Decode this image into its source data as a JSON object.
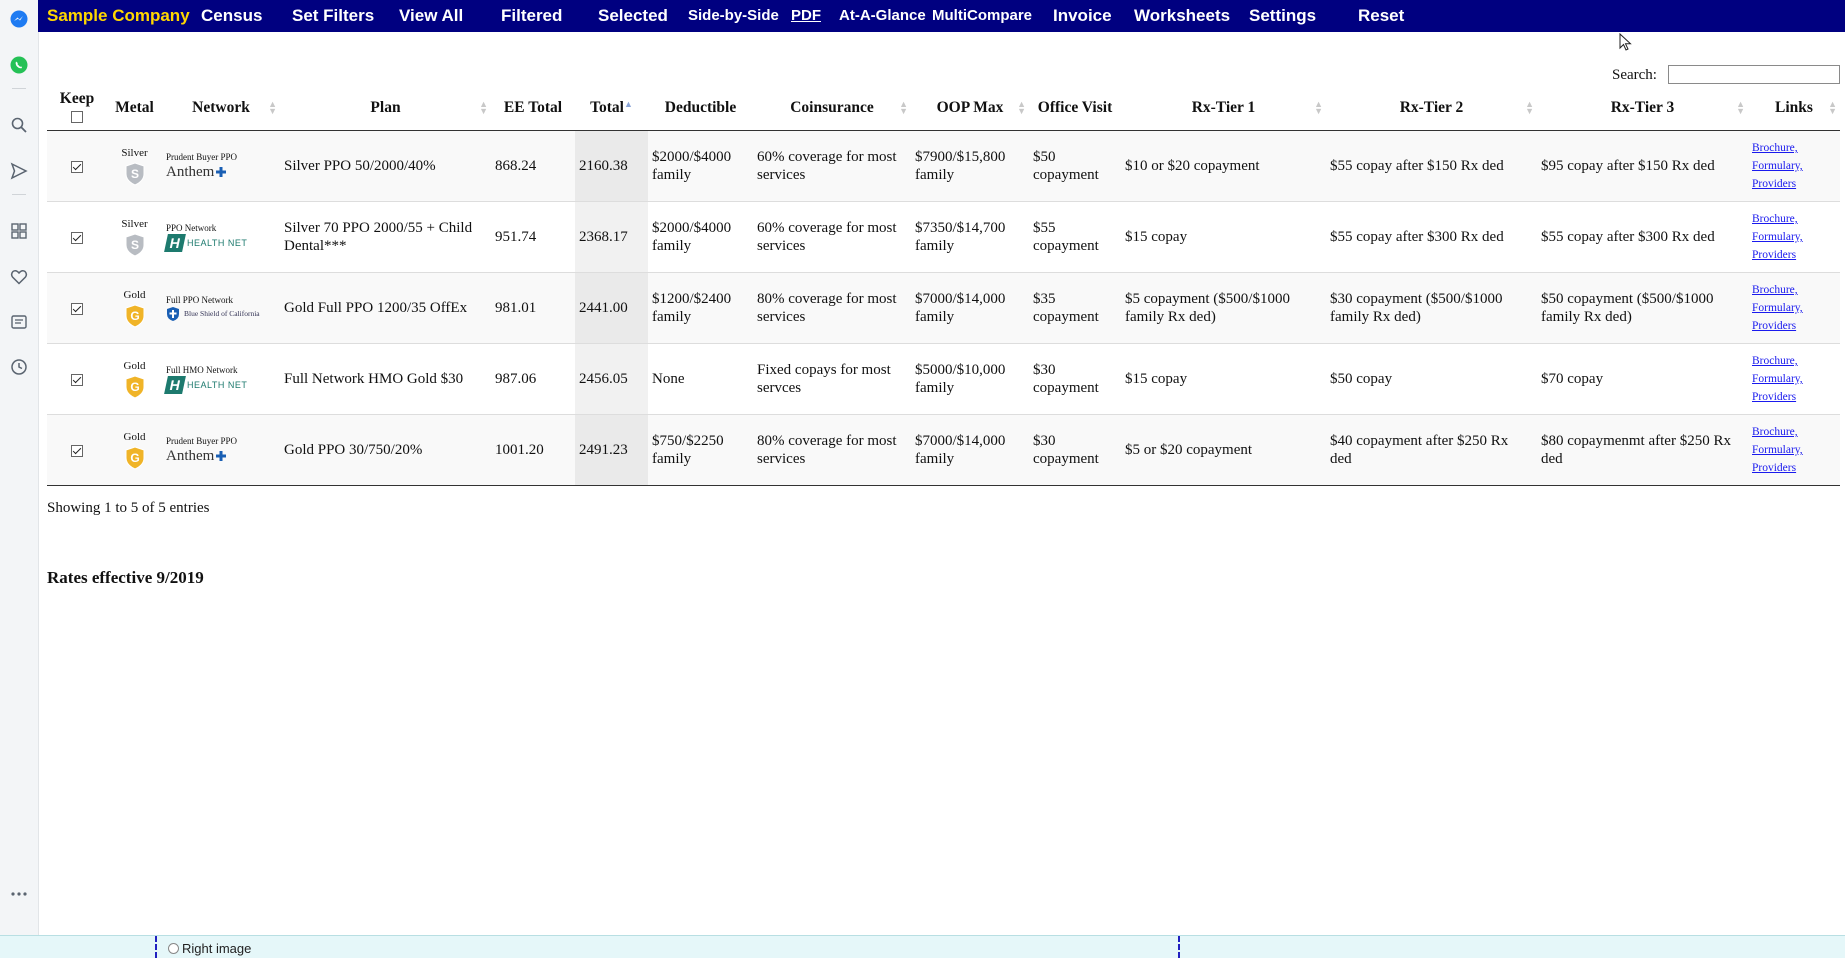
{
  "nav": {
    "brand": "Sample Company",
    "items": [
      "Census",
      "Set Filters",
      "View All",
      "Filtered",
      "Selected",
      "Side-by-Side",
      "PDF",
      "At-A-Glance",
      "MultiCompare",
      "Invoice",
      "Worksheets",
      "Settings",
      "Reset"
    ]
  },
  "sidebar": {
    "icons": [
      "messenger-icon",
      "whatsapp-icon",
      "search-icon",
      "send-icon",
      "apps-grid-icon",
      "heart-icon",
      "news-icon",
      "clock-icon",
      "more-icon"
    ]
  },
  "search": {
    "label": "Search:",
    "value": "",
    "placeholder": ""
  },
  "table": {
    "headers": {
      "keep": "Keep",
      "metal": "Metal",
      "network": "Network",
      "plan": "Plan",
      "ee_total": "EE Total",
      "total": "Total",
      "deductible": "Deductible",
      "coinsurance": "Coinsurance",
      "oop_max": "OOP Max",
      "office_visit": "Office Visit",
      "rx1": "Rx-Tier 1",
      "rx2": "Rx-Tier 2",
      "rx3": "Rx-Tier 3",
      "links": "Links"
    },
    "rows": [
      {
        "metal": "Silver",
        "badge_letter": "S",
        "badge_color": "#b8bcc2",
        "network_label": "Prudent Buyer PPO",
        "carrier": "Anthem",
        "plan": "Silver PPO 50/2000/40%",
        "ee_total": "868.24",
        "total": "2160.38",
        "deductible": "$2000/$4000 family",
        "coinsurance": "60% coverage for most services",
        "oop_max": "$7900/$15,800 family",
        "office_visit": "$50 copayment",
        "rx1": "$10 or $20 copayment",
        "rx2": "$55 copay after $150 Rx ded",
        "rx3": "$95 copay after $150 Rx ded",
        "links": [
          "Brochure,",
          "Formulary,",
          "Providers"
        ]
      },
      {
        "metal": "Silver",
        "badge_letter": "S",
        "badge_color": "#b8bcc2",
        "network_label": "PPO Network",
        "carrier": "HEALTH NET",
        "plan": "Silver 70 PPO 2000/55 + Child Dental***",
        "ee_total": "951.74",
        "total": "2368.17",
        "deductible": "$2000/$4000 family",
        "coinsurance": "60% coverage for most services",
        "oop_max": "$7350/$14,700 family",
        "office_visit": "$55 copayment",
        "rx1": "$15 copay",
        "rx2": "$55 copay after $300 Rx ded",
        "rx3": "$55 copay after $300 Rx ded",
        "links": [
          "Brochure,",
          "Formulary,",
          "Providers"
        ]
      },
      {
        "metal": "Gold",
        "badge_letter": "G",
        "badge_color": "#f0b428",
        "network_label": "Full PPO Network",
        "carrier": "Blue Shield of California",
        "plan": "Gold Full PPO 1200/35 OffEx",
        "ee_total": "981.01",
        "total": "2441.00",
        "deductible": "$1200/$2400 family",
        "coinsurance": "80% coverage for most services",
        "oop_max": "$7000/$14,000 family",
        "office_visit": "$35 copayment",
        "rx1": "$5 copayment ($500/$1000 family Rx ded)",
        "rx2": "$30 copayment ($500/$1000 family Rx ded)",
        "rx3": "$50 copayment ($500/$1000 family Rx ded)",
        "links": [
          "Brochure,",
          "Formulary,",
          "Providers"
        ]
      },
      {
        "metal": "Gold",
        "badge_letter": "G",
        "badge_color": "#f0b428",
        "network_label": "Full HMO Network",
        "carrier": "HEALTH NET",
        "plan": "Full Network HMO Gold $30",
        "ee_total": "987.06",
        "total": "2456.05",
        "deductible": "None",
        "coinsurance": "Fixed copays for most servces",
        "oop_max": "$5000/$10,000 family",
        "office_visit": "$30 copayment",
        "rx1": "$15 copay",
        "rx2": "$50 copay",
        "rx3": "$70 copay",
        "links": [
          "Brochure,",
          "Formulary,",
          "Providers"
        ]
      },
      {
        "metal": "Gold",
        "badge_letter": "G",
        "badge_color": "#f0b428",
        "network_label": "Prudent Buyer PPO",
        "carrier": "Anthem",
        "plan": "Gold PPO 30/750/20%",
        "ee_total": "1001.20",
        "total": "2491.23",
        "deductible": "$750/$2250 family",
        "coinsurance": "80% coverage for most services",
        "oop_max": "$7000/$14,000 family",
        "office_visit": "$30 copayment",
        "rx1": "$5 or $20 copayment",
        "rx2": "$40 copayment after $250 Rx ded",
        "rx3": "$80 copaymenmt after $250 Rx ded",
        "links": [
          "Brochure,",
          "Formulary,",
          "Providers"
        ]
      }
    ]
  },
  "info": "Showing 1 to 5 of 5 entries",
  "rates_note": "Rates effective 9/2019",
  "bottom": {
    "label": "Right image"
  },
  "colors": {
    "nav_bg": "#000080",
    "brand": "#ffd700",
    "link": "#1a1aee"
  }
}
